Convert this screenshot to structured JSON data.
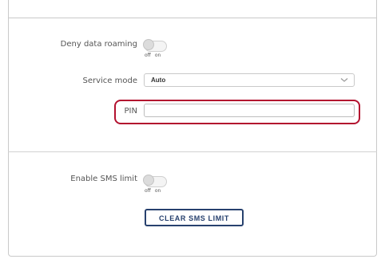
{
  "settings": {
    "deny_data_roaming": {
      "label": "Deny data roaming",
      "state": "off",
      "off_label": "off",
      "on_label": "on"
    },
    "service_mode": {
      "label": "Service mode",
      "value": "Auto",
      "chevron_icon": "chevron-down-icon"
    },
    "pin": {
      "label": "PIN",
      "value": "",
      "highlight_color": "#b3112f"
    },
    "enable_sms_limit": {
      "label": "Enable SMS limit",
      "state": "off",
      "off_label": "off",
      "on_label": "on"
    },
    "clear_sms_limit_button": {
      "label": "CLEAR SMS LIMIT",
      "color": "#27416e"
    }
  }
}
